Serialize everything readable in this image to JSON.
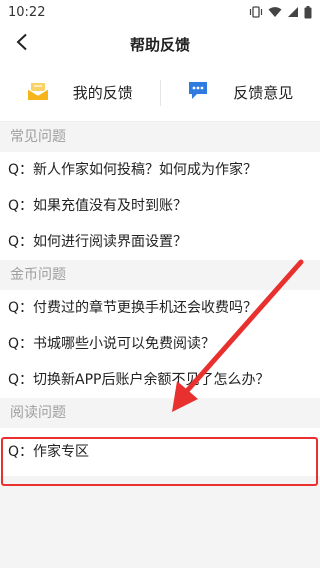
{
  "status_bar": {
    "time": "10:22"
  },
  "header": {
    "title": "帮助反馈"
  },
  "top_actions": [
    {
      "label": "我的反馈",
      "icon": "mail-icon"
    },
    {
      "label": "反馈意见",
      "icon": "chat-icon"
    }
  ],
  "sections": [
    {
      "title": "常见问题",
      "items": [
        "Q：新人作家如何投稿？如何成为作家？",
        "Q：如果充值没有及时到账？",
        "Q：如何进行阅读界面设置？"
      ]
    },
    {
      "title": "金币问题",
      "items": [
        "Q：付费过的章节更换手机还会收费吗？",
        "Q：书城哪些小说可以免费阅读？",
        "Q：切换新APP后账户余额不见了怎么办？"
      ]
    },
    {
      "title": "阅读问题",
      "items": [
        "Q：作家专区"
      ]
    }
  ],
  "colors": {
    "accent_yellow": "#f5b51b",
    "accent_blue": "#2f7be0",
    "annotation_red": "#e8312f"
  }
}
